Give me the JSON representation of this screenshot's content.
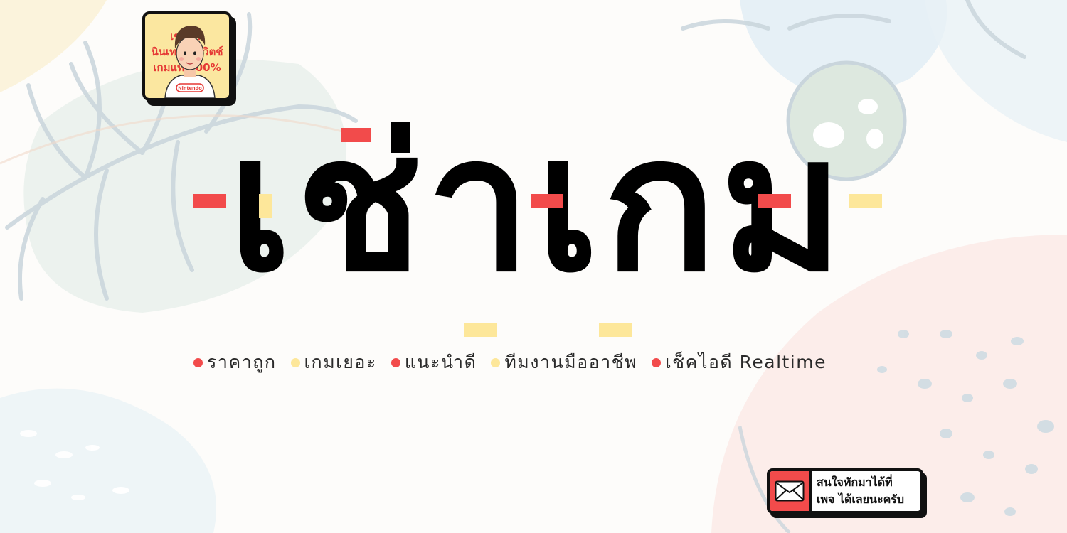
{
  "logo": {
    "lines": [
      "เช่าเกม",
      "นินเทนโดสวิตช์",
      "เกมแท้ 100%"
    ],
    "shirt_text": "Nintendo"
  },
  "title": "เช่าเกม",
  "features": [
    {
      "text": "ราคาถูก",
      "dot": "#f24b4b"
    },
    {
      "text": "เกมเยอะ",
      "dot": "#fde79a"
    },
    {
      "text": "แนะนำดี",
      "dot": "#f24b4b"
    },
    {
      "text": "ทีมงานมืออาชีพ",
      "dot": "#fde79a"
    },
    {
      "text": "เช็คไอดี Realtime",
      "dot": "#f24b4b"
    }
  ],
  "contact": {
    "icon": "mail-icon",
    "line1": "สนใจทักมาได้ที่",
    "line2": "เพจ ได้เลยนะครับ"
  },
  "colors": {
    "accent_red": "#f24b4b",
    "accent_yellow": "#fde79a",
    "ink": "#000000"
  }
}
